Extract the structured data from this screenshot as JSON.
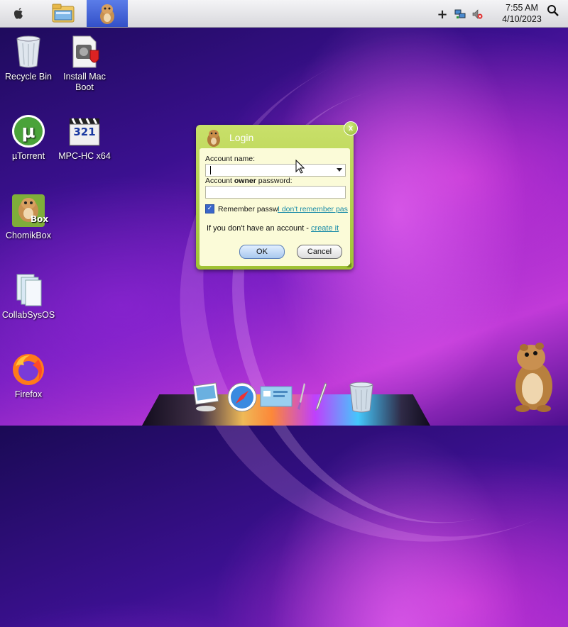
{
  "taskbar": {
    "apple_icon": "apple-logo-icon",
    "pinned": [
      {
        "name": "file-explorer",
        "icon": "folder-explorer-icon"
      },
      {
        "name": "chomikbox",
        "icon": "hamster-icon"
      }
    ],
    "tray": {
      "plus_label": "+",
      "clock_time": "7:55 AM",
      "clock_date": "4/10/2023"
    }
  },
  "desktop": {
    "icons": [
      {
        "label": "Recycle Bin",
        "icon": "recycle-bin-icon"
      },
      {
        "label": "Install Mac Boot",
        "icon": "installer-icon"
      },
      {
        "label": "µTorrent",
        "icon": "utorrent-icon"
      },
      {
        "label": "MPC-HC x64",
        "icon": "mpc-hc-icon"
      },
      {
        "label": "ChomikBox",
        "icon": "chomikbox-icon"
      },
      {
        "label": "CollabSysOS",
        "icon": "documents-icon"
      },
      {
        "label": "Firefox",
        "icon": "firefox-icon"
      }
    ],
    "mpc_badge": "321",
    "chomik_badge": "Box"
  },
  "login": {
    "title": "Login",
    "close_label": "x",
    "account_name_label": "Account name:",
    "account_name_value": "",
    "password_label_pre": "Account ",
    "password_label_bold": "owner",
    "password_label_post": " password:",
    "password_value": "",
    "remember_label": "Remember passw",
    "remember_checked": true,
    "forgot_link": "I don't remember pas",
    "no_account_text": "If you don't have an account - ",
    "create_link": "create it",
    "ok_label": "OK",
    "cancel_label": "Cancel"
  },
  "dock": {
    "items": [
      "preview-icon",
      "safari-compass-icon",
      "screen-sharing-icon",
      "brush-icon",
      "pen-icon",
      "trash-icon"
    ]
  },
  "colors": {
    "dialog_green": "#a6c83a",
    "dialog_body": "#fbfbd8",
    "link": "#1a8ca8"
  }
}
